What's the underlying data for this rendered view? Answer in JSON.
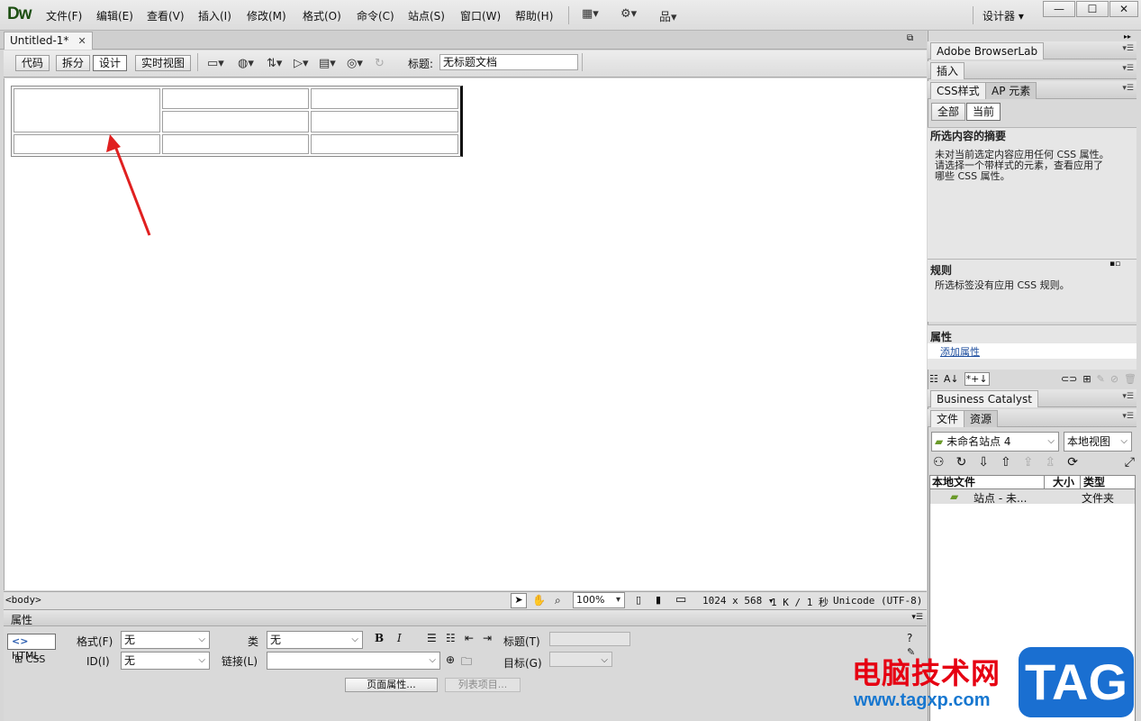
{
  "app": {
    "logo": "Dw"
  },
  "menu": [
    "文件(F)",
    "编辑(E)",
    "查看(V)",
    "插入(I)",
    "修改(M)",
    "格式(O)",
    "命令(C)",
    "站点(S)",
    "窗口(W)",
    "帮助(H)"
  ],
  "workspace": {
    "label": "设计器",
    "arrow": "▾"
  },
  "window_controls": {
    "minimize": "—",
    "maximize": "☐",
    "close": "✕"
  },
  "document": {
    "tab_title": "Untitled-1*",
    "close": "✕"
  },
  "view_buttons": {
    "code": "代码",
    "split": "拆分",
    "design": "设计",
    "live": "实时视图"
  },
  "title_field": {
    "label": "标题:",
    "value": "无标题文档"
  },
  "status": {
    "tag": "<body>",
    "zoom": "100%",
    "size": "1024 x 568",
    "weight": "1 K / 1 秒",
    "encoding": "Unicode (UTF-8)"
  },
  "properties": {
    "header": "属性",
    "html_btn": "HTML",
    "css_btn": "CSS",
    "format_label": "格式(F)",
    "format_value": "无",
    "id_label": "ID(I)",
    "id_value": "无",
    "class_label": "类",
    "class_value": "无",
    "link_label": "链接(L)",
    "link_value": "",
    "title_label": "标题(T)",
    "target_label": "目标(G)",
    "bold": "B",
    "italic": "I",
    "page_props": "页面属性...",
    "list_item": "列表项目..."
  },
  "right_panel": {
    "browserlab": "Adobe BrowserLab",
    "insert": "插入",
    "css_styles": "CSS样式",
    "ap_elements": "AP 元素",
    "all": "全部",
    "current": "当前",
    "summary_title": "所选内容的摘要",
    "summary_text_1": "未对当前选定内容应用任何 CSS 属性。",
    "summary_text_2": "请选择一个带样式的元素，查看应用了",
    "summary_text_3": "哪些 CSS 属性。",
    "rules_title": "规则",
    "rules_text": "所选标签没有应用 CSS 规则。",
    "props_title": "属性",
    "add_prop": "添加属性",
    "business_catalyst": "Business Catalyst",
    "files": "文件",
    "assets": "资源",
    "site": "未命名站点 4",
    "view": "本地视图",
    "col_local": "本地文件",
    "col_size": "大小",
    "col_type": "类型",
    "row_name": "站点 - 未...",
    "row_type": "文件夹"
  },
  "watermark": {
    "text": "电脑技术网",
    "url": "www.tagxp.com",
    "tag": "TAG"
  },
  "colors": {
    "arrow": "#e02020",
    "logo": "#1d4f12",
    "watermark_red": "#e60012",
    "watermark_blue": "#1a6fd1"
  }
}
